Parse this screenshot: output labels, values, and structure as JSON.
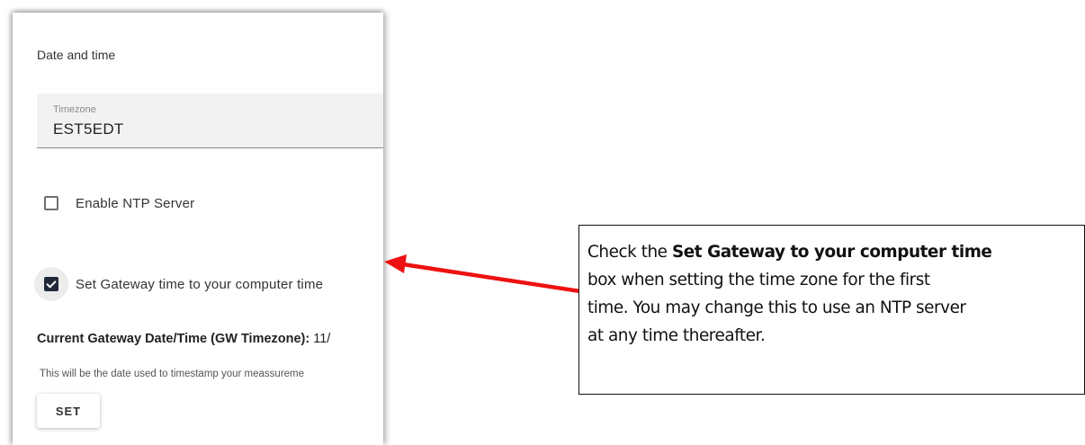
{
  "panel": {
    "section_title": "Date and time",
    "timezone": {
      "label": "Timezone",
      "value": "EST5EDT"
    },
    "ntp_checkbox": {
      "label": "Enable NTP Server",
      "checked": false
    },
    "gateway_time_checkbox": {
      "label": "Set Gateway time to your computer time",
      "checked": true
    },
    "current_datetime": {
      "label": "Current Gateway Date/Time (GW Timezone):",
      "value": "11/"
    },
    "note": "This will be the date used to timestamp your meassureme",
    "set_button": "SET"
  },
  "callout": {
    "line1_prefix": "Check the ",
    "line1_bold": "Set Gateway to your computer time",
    "line2": "box when setting the time zone for the first",
    "line3": "time. You may change this to use  an NTP server",
    "line4": "at any time thereafter."
  },
  "colors": {
    "arrow": "#ee1111",
    "checkbox_checked": "#1f2937",
    "field_background": "#f2f2f2"
  }
}
